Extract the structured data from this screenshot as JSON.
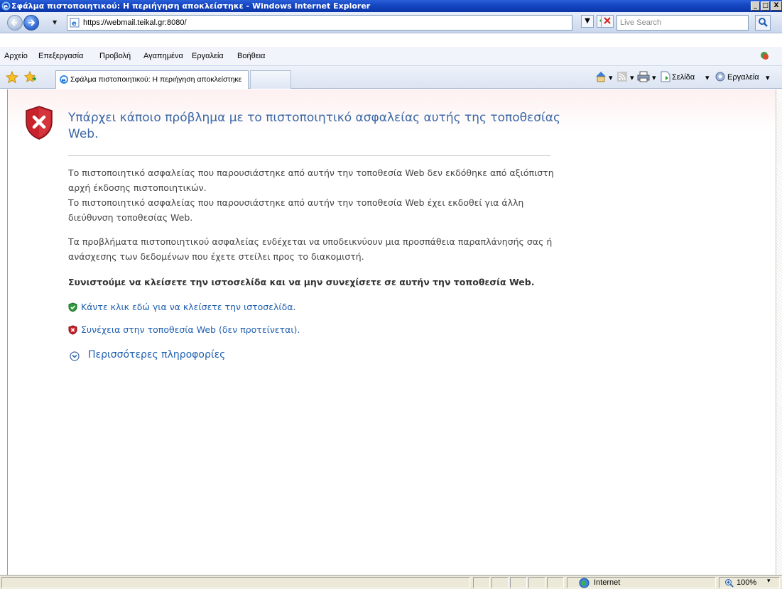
{
  "window": {
    "title": "Σφάλμα πιστοποιητικού: Η περιήγηση αποκλείστηκε - Windows Internet Explorer",
    "minimize": "_",
    "maximize": "□",
    "close": "X"
  },
  "address_bar": {
    "url": "https://webmail.teikal.gr:8080/",
    "search_placeholder": "Live Search"
  },
  "menu": {
    "items": [
      "Αρχείο",
      "Επεξεργασία",
      "Προβολή",
      "Αγαπημένα",
      "Εργαλεία",
      "Βοήθεια"
    ]
  },
  "tabs": {
    "active_label": "Σφάλμα πιστοποιητικού: Η περιήγηση αποκλείστηκε"
  },
  "command_bar": {
    "page_label": "Σελίδα",
    "tools_label": "Εργαλεία"
  },
  "content": {
    "heading": "Υπάρχει κάποιο πρόβλημα με το πιστοποιητικό ασφαλείας αυτής της τοποθεσίας Web.",
    "para1_line1": "Το πιστοποιητικό ασφαλείας που παρουσιάστηκε από αυτήν την τοποθεσία Web δεν εκδόθηκε από αξιόπιστη αρχή έκδοσης πιστοποιητικών.",
    "para1_line2": "Το πιστοποιητικό ασφαλείας που παρουσιάστηκε από αυτήν την τοποθεσία Web έχει εκδοθεί για άλλη διεύθυνση τοποθεσίας Web.",
    "para2": "Τα προβλήματα πιστοποιητικού ασφαλείας ενδέχεται να υποδεικνύουν μια προσπάθεια παραπλάνησής σας ή ανάσχεσης των δεδομένων που έχετε στείλει προς το διακομιστή.",
    "recommendation": "Συνιστούμε να κλείσετε την ιστοσελίδα και να μην συνεχίσετε σε αυτήν την τοποθεσία Web.",
    "close_link": "Κάντε κλικ εδώ για να κλείσετε την ιστοσελίδα.",
    "continue_link": "Συνέχεια στην τοποθεσία Web (δεν προτείνεται).",
    "more_info": "Περισσότερες πληροφορίες"
  },
  "status_bar": {
    "zone": "Internet",
    "zoom": "100%"
  },
  "colors": {
    "title_bar": "#1747c4",
    "heading": "#3b67a6",
    "link": "#1f5fb0",
    "shield_red": "#c8232c"
  }
}
